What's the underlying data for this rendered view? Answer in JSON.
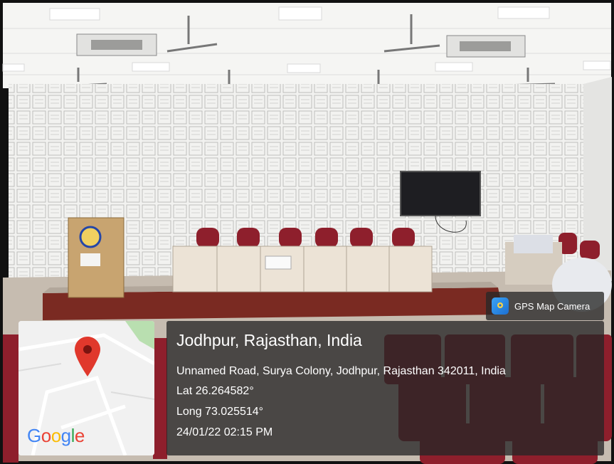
{
  "gps_badge": {
    "label": "GPS Map Camera",
    "icon": "gps-map-camera-icon"
  },
  "map": {
    "logo_text": "Google",
    "pin_icon": "map-pin-icon",
    "pin_color": "#e0382c"
  },
  "location": {
    "title": "Jodhpur, Rajasthan, India",
    "address": "Unnamed Road, Surya Colony, Jodhpur, Rajasthan 342011, India",
    "lat": "Lat 26.264582°",
    "long": "Long 73.025514°",
    "datetime": "24/01/22 02:15 PM"
  },
  "colors": {
    "panel_bg": "#262626",
    "chair_red": "#8e1f2c",
    "stage_red": "#7a2a22"
  }
}
